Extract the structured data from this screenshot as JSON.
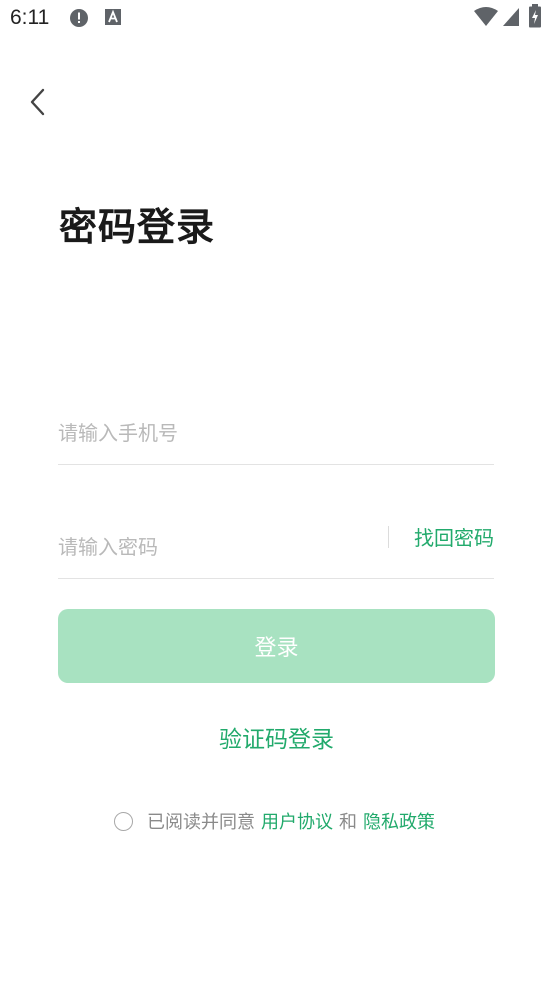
{
  "status_bar": {
    "time": "6:11",
    "icons": [
      "alert-circle-icon",
      "font-a-icon",
      "wifi-icon",
      "signal-icon",
      "battery-icon"
    ]
  },
  "header": {
    "back_icon": "chevron-left-icon",
    "title": "密码登录"
  },
  "form": {
    "phone": {
      "value": "",
      "placeholder": "请输入手机号"
    },
    "password": {
      "value": "",
      "placeholder": "请输入密码"
    },
    "find_password_label": "找回密码",
    "login_label": "登录",
    "sms_login_label": "验证码登录"
  },
  "agreement": {
    "prefix": "已阅读并同意",
    "user_agreement": "用户协议",
    "conjunction": "和",
    "privacy_policy": "隐私政策",
    "checked": false
  },
  "colors": {
    "accent": "#22aa6c",
    "button_disabled": "#a8e2c1",
    "placeholder": "#b9b9b9",
    "divider": "#e3e3e3"
  }
}
